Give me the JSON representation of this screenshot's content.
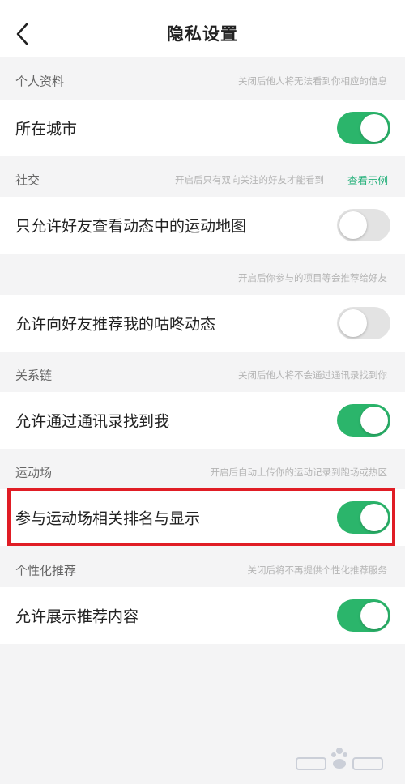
{
  "header": {
    "title": "隐私设置",
    "back_icon": "chevron-left-icon"
  },
  "sections": {
    "profile": {
      "label": "个人资料",
      "note": "关闭后他人将无法看到你相应的信息"
    },
    "social": {
      "label": "社交",
      "note": "开启后只有双向关注的好友才能看到",
      "link": "查看示例"
    },
    "recommend_note": {
      "note": "开启后你参与的项目等会推荐给好友"
    },
    "contacts": {
      "label": "关系链",
      "note": "关闭后他人将不会通过通讯录找到你"
    },
    "arena": {
      "label": "运动场",
      "note": "开启后自动上传你的运动记录到跑场或热区"
    },
    "personalized": {
      "label": "个性化推荐",
      "note": "关闭后将不再提供个性化推荐服务"
    }
  },
  "settings": [
    {
      "label": "所在城市",
      "enabled": true
    },
    {
      "label": "只允许好友查看动态中的运动地图",
      "enabled": false
    },
    {
      "label": "允许向好友推荐我的咕咚动态",
      "enabled": false
    },
    {
      "label": "允许通过通讯录找到我",
      "enabled": true
    },
    {
      "label": "参与运动场相关排名与显示",
      "enabled": true,
      "highlighted": true
    },
    {
      "label": "允许展示推荐内容",
      "enabled": true
    }
  ],
  "colors": {
    "accent": "#2bb56b",
    "link": "#24b07a",
    "toggle_off": "#e3e3e3",
    "highlight_border": "#e01d25",
    "background": "#f4f4f5"
  }
}
